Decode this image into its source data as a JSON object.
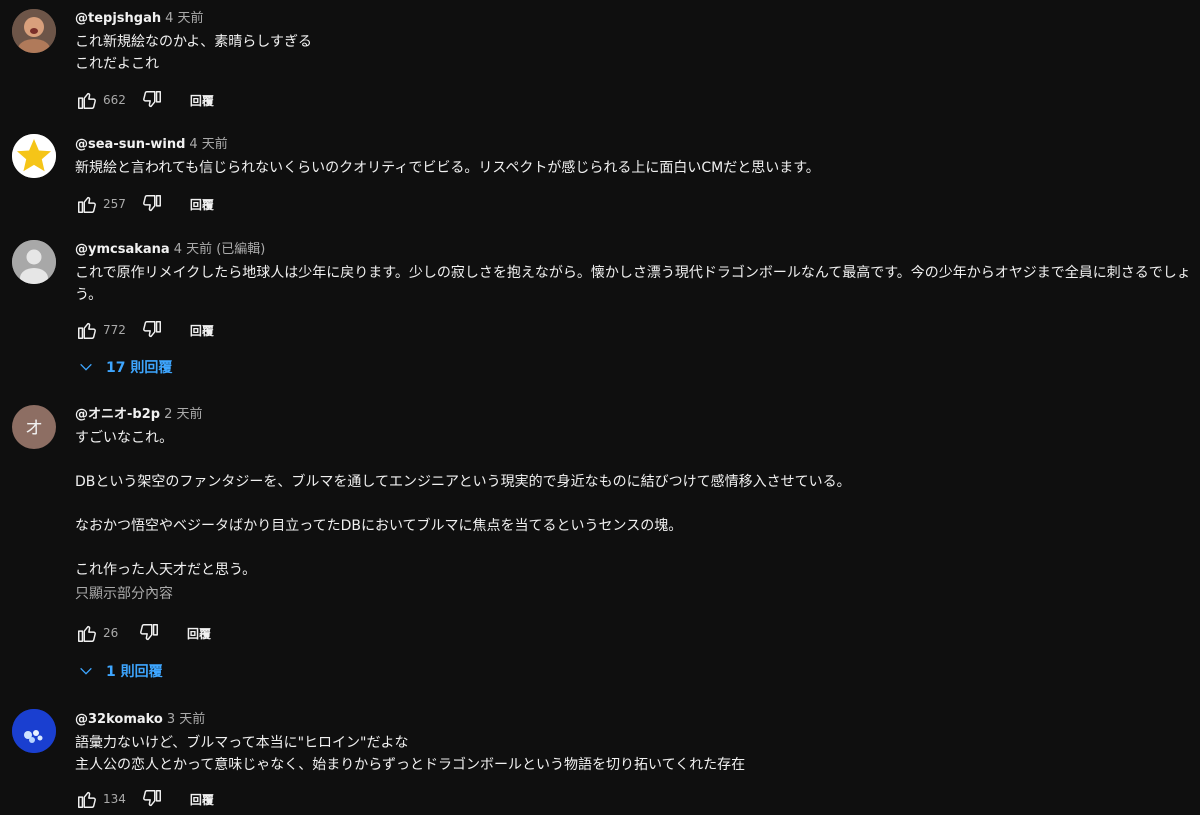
{
  "reply_label": "回覆",
  "comments": [
    {
      "handle": "@tepjshgah",
      "time": "4 天前",
      "text": "これ新規絵なのかよ、素晴らしすぎる\nこれだよこれ",
      "likes": "662",
      "avatar_color": "#8a6a5a"
    },
    {
      "handle": "@sea-sun-wind",
      "time": "4 天前",
      "text": "新規絵と言われても信じられないくらいのクオリティでビビる。リスペクトが感じられる上に面白いCMだと思います。",
      "likes": "257",
      "avatar_color": "#ffffff"
    },
    {
      "handle": "@ymcsakana",
      "time": "4 天前 (已編輯)",
      "text": "これで原作リメイクしたら地球人は少年に戻ります。少しの寂しさを抱えながら。懐かしさ漂う現代ドラゴンボールなんて最高です。今の少年からオヤジまで全員に刺さるでしょう。",
      "likes": "772",
      "replies": "17 則回覆",
      "avatar_color": "#b3b3b3"
    },
    {
      "handle": "@オニオ-b2p",
      "time": "2 天前",
      "avatar_letter": "オ",
      "text": "すごいなこれ。\n\nDBという架空のファンタジーを、ブルマを通してエンジニアという現実的で身近なものに結びつけて感情移入させている。\n\nなおかつ悟空やベジータばかり目立ってたDBにおいてブルマに焦点を当てるというセンスの塊。\n\nこれ作った人天才だと思う。",
      "more": "只顯示部分內容",
      "likes": "26",
      "replies": "1 則回覆",
      "avatar_color": "#8d6e63"
    },
    {
      "handle": "@32komako",
      "time": "3 天前",
      "text": "語彙力ないけど、ブルマって本当に\"ヒロイン\"だよな\n主人公の恋人とかって意味じゃなく、始まりからずっとドラゴンボールという物語を切り拓いてくれた存在",
      "likes": "134",
      "avatar_color": "#1a3fd0"
    }
  ]
}
